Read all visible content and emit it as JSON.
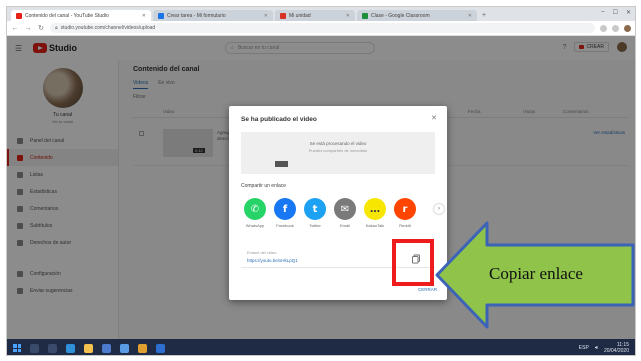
{
  "browser": {
    "tabs": [
      {
        "label": "Contenido del canal - YouTube Studio",
        "favicon": "#e62117",
        "active": true
      },
      {
        "label": "Crear tarea - Mi formulario",
        "favicon": "#1a73e8",
        "active": false
      },
      {
        "label": "Mi unidad",
        "favicon": "#d93025",
        "active": false
      },
      {
        "label": "Clase - Google Classroom",
        "favicon": "#1e8e3e",
        "active": false
      }
    ],
    "url": "studio.youtube.com/channel/videos/upload"
  },
  "header": {
    "logo_text": "Studio",
    "search_placeholder": "Buscar en tu canal",
    "create_label": "CREAR"
  },
  "sidebar": {
    "channel_name": "Tu canal",
    "channel_sub": "Ver tu canal",
    "items": [
      {
        "label": "Panel del canal",
        "active": false
      },
      {
        "label": "Contenido",
        "active": true
      },
      {
        "label": "Listas",
        "active": false
      },
      {
        "label": "Estadísticas",
        "active": false
      },
      {
        "label": "Comentarios",
        "active": false
      },
      {
        "label": "Subtítulos",
        "active": false
      },
      {
        "label": "Derechos de autor",
        "active": false
      },
      {
        "label": "Configuración",
        "active": false
      },
      {
        "label": "Enviar sugerencias",
        "active": false
      }
    ]
  },
  "content": {
    "title": "Contenido del canal",
    "tabs": [
      "Videos",
      "En vivo"
    ],
    "filter": "Filtrar",
    "columns": [
      "Video",
      "Visibilidad",
      "Restricciones",
      "Fecha",
      "Vistas",
      "Comentarios"
    ],
    "row": {
      "duration": "0:12",
      "desc": "Agregar descripción",
      "link": "Ver estadísticas"
    }
  },
  "modal": {
    "title": "Se ha publicado el video",
    "preview_line1": "Se está procesando el video",
    "preview_line2": "Puedes compartirlo de inmediato",
    "share_label": "Compartir un enlace",
    "share_buttons": [
      {
        "name": "WhatsApp",
        "glyph": "✆",
        "color": "#25d366"
      },
      {
        "name": "Facebook",
        "glyph": "f",
        "color": "#1877f2"
      },
      {
        "name": "Twitter",
        "glyph": "t",
        "color": "#1da1f2"
      },
      {
        "name": "Email",
        "glyph": "✉",
        "color": "#7a7a7a"
      },
      {
        "name": "KakaoTalk",
        "glyph": "…",
        "color": "#f7e600"
      },
      {
        "name": "Reddit",
        "glyph": "r",
        "color": "#ff4500"
      }
    ],
    "link_label": "Enlace del video",
    "link_url": "https://youtu.be/xHkLpQ1",
    "close_label": "CERRAR"
  },
  "callout": {
    "text": "Copiar enlace",
    "fill": "#8fc34a",
    "stroke": "#3b63b8"
  },
  "highlight_color": "#ee1c1c",
  "taskbar": {
    "time": "11:15",
    "date": "20/04/2020",
    "lang": "ESP"
  }
}
